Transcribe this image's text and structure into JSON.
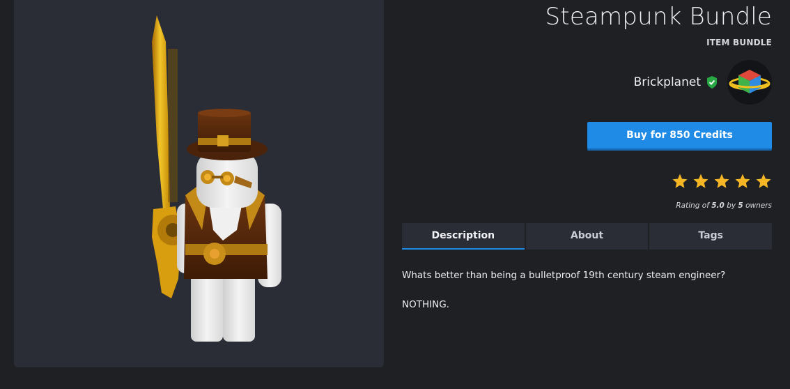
{
  "item": {
    "title": "Steampunk Bundle",
    "type_label": "ITEM BUNDLE"
  },
  "creator": {
    "name": "Brickplanet",
    "verified": true,
    "verified_color": "#27a844"
  },
  "purchase": {
    "buy_label": "Buy for 850 Credits",
    "button_color": "#1f8be6"
  },
  "rating": {
    "stars": 5,
    "max_stars": 5,
    "star_color": "#f5b626",
    "text_prefix": "Rating of ",
    "value": "5.0",
    "text_by": " by ",
    "owners_count": "5",
    "text_suffix": " owners"
  },
  "tabs": [
    {
      "label": "Description",
      "active": true
    },
    {
      "label": "About",
      "active": false
    },
    {
      "label": "Tags",
      "active": false
    }
  ],
  "description": {
    "line1": "Whats better than being a bulletproof 19th century steam engineer?",
    "line2": "NOTHING."
  },
  "preview": {
    "icon": "avatar-3d-preview"
  }
}
